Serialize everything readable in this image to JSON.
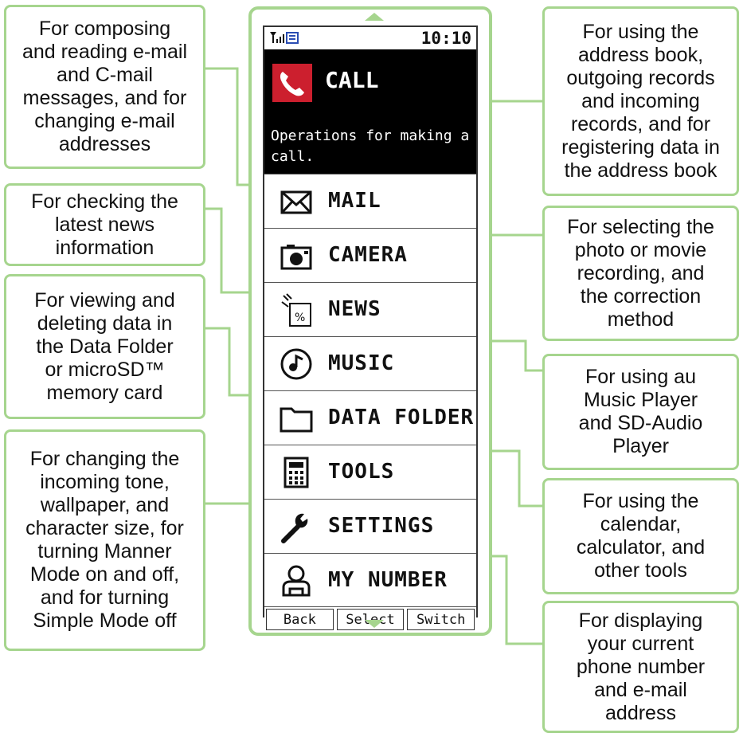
{
  "status": {
    "signal_icon": "signal-battery-icon",
    "time": "10:10"
  },
  "call": {
    "label": "CALL",
    "description": "Operations for making a call."
  },
  "menu": [
    {
      "label": "MAIL",
      "icon": "mail-icon"
    },
    {
      "label": "CAMERA",
      "icon": "camera-icon"
    },
    {
      "label": "NEWS",
      "icon": "news-icon"
    },
    {
      "label": "MUSIC",
      "icon": "music-icon"
    },
    {
      "label": "DATA FOLDER",
      "icon": "folder-icon"
    },
    {
      "label": "TOOLS",
      "icon": "calculator-icon"
    },
    {
      "label": "SETTINGS",
      "icon": "wrench-icon"
    },
    {
      "label": "MY NUMBER",
      "icon": "person-icon"
    }
  ],
  "softkeys": {
    "back": "Back",
    "select": "Select",
    "switch": "Switch"
  },
  "callouts": {
    "mail": "For composing\nand reading e-mail\nand C-mail\nmessages, and for\nchanging e-mail\naddresses",
    "news": "For checking the\nlatest news\ninformation",
    "data_folder": "For viewing and\ndeleting data in\nthe Data Folder\nor microSD™\nmemory card",
    "settings": "For changing the\nincoming tone,\nwallpaper, and\ncharacter size, for\nturning Manner\nMode on and off,\nand for turning\nSimple Mode off",
    "call": "For using the\naddress book,\noutgoing records\nand incoming\nrecords, and for\nregistering data in\nthe address book",
    "camera": "For selecting the\nphoto or movie\nrecording, and\nthe correction\nmethod",
    "music": "For using au\nMusic Player\nand SD-Audio\nPlayer",
    "tools": "For using the\ncalendar,\ncalculator, and\nother tools",
    "my_number": "For displaying\nyour current\nphone number\nand e-mail\naddress"
  },
  "colors": {
    "accent": "#a6d58e",
    "call_icon": "#cc1f2e",
    "call_panel": "#000000"
  }
}
